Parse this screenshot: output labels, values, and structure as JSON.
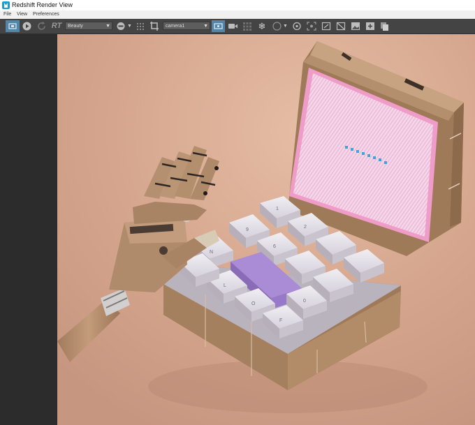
{
  "window": {
    "title": "Redshift Render View"
  },
  "menu": {
    "file": "File",
    "view": "View",
    "preferences": "Preferences"
  },
  "toolbar": {
    "rt_label": "RT",
    "aov_select": "Beauty",
    "camera_select": "camera1"
  },
  "render": {
    "keys": {
      "k1": "1",
      "k2": "2",
      "k6": "6",
      "k9": "9",
      "kN": "N",
      "kL": "L",
      "kO": "O",
      "kF": "F",
      "k0": "0"
    },
    "accent_purple": "#a98bd6",
    "screen_pink": "#f4cbe4",
    "screen_dots": "#3aa6d8"
  }
}
